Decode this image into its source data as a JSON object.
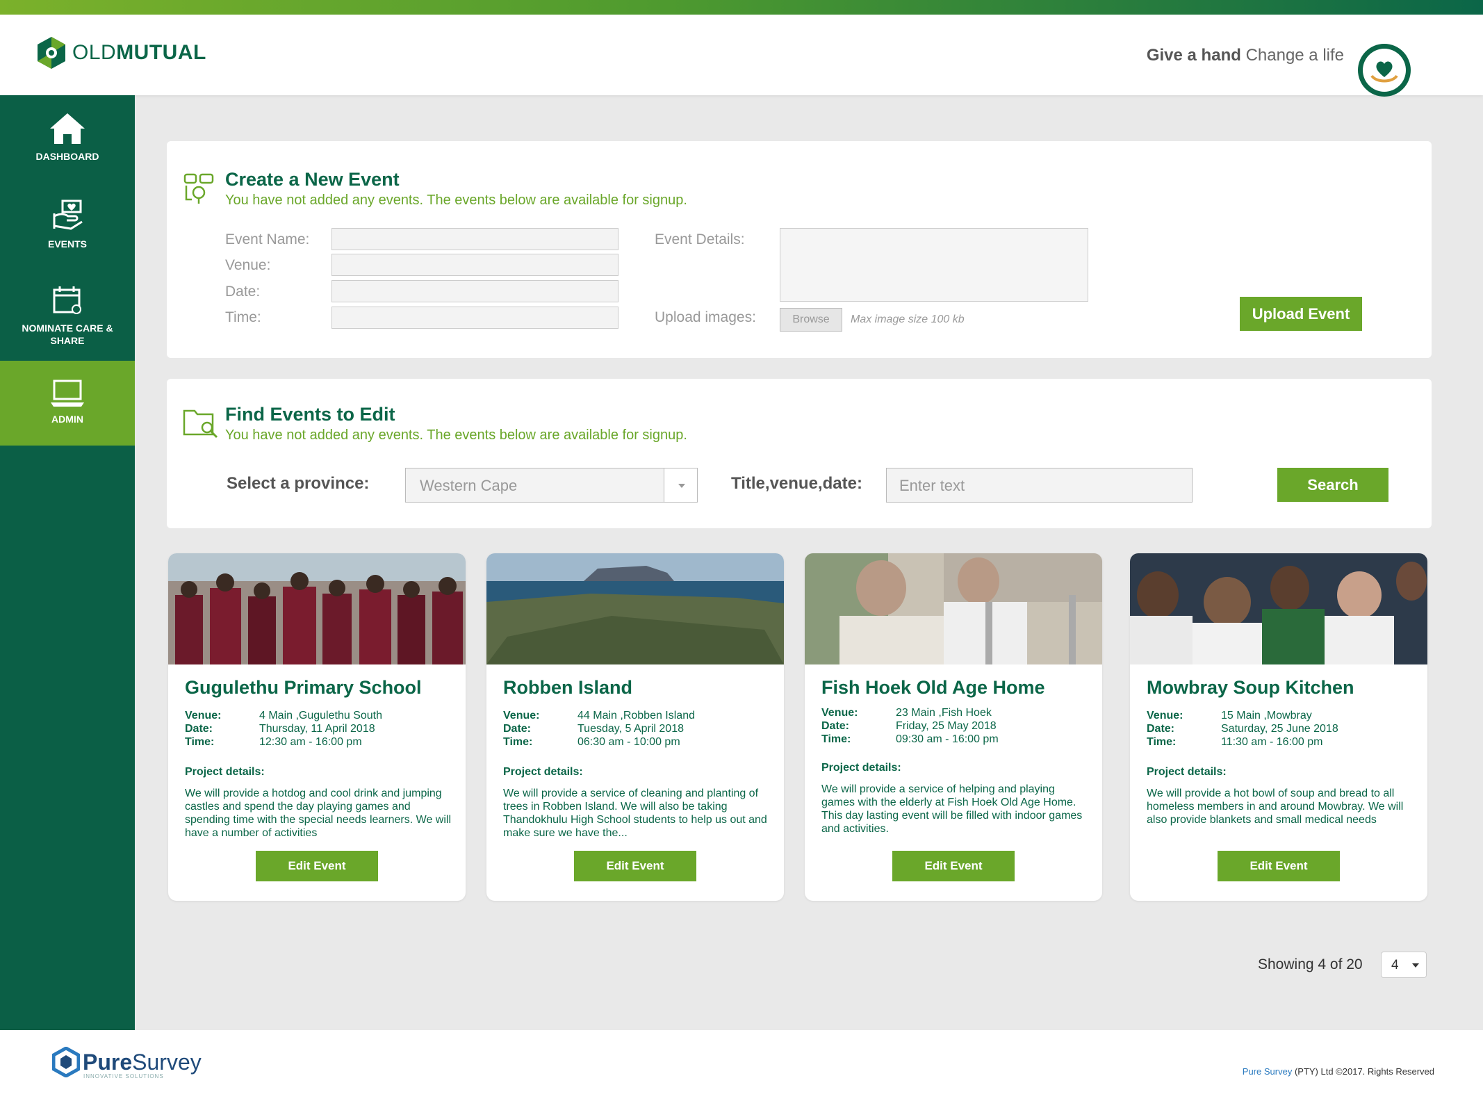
{
  "brand": {
    "part1": "OLD",
    "part2": "MUTUAL"
  },
  "slogan": {
    "bold": "Give a hand",
    "rest": "Change a life"
  },
  "sidebar": {
    "items": [
      {
        "label": "DASHBOARD",
        "icon": "home-icon"
      },
      {
        "label": "EVENTS",
        "icon": "events-hands-icon"
      },
      {
        "label": "NOMINATE CARE & SHARE",
        "icon": "calendar-icon"
      },
      {
        "label": "ADMIN",
        "icon": "laptop-icon",
        "active": true
      }
    ]
  },
  "create": {
    "title": "Create a New Event",
    "subtitle": "You have not added any events. The events below are available for signup.",
    "labels": {
      "event_name": "Event Name:",
      "venue": "Venue:",
      "date": "Date:",
      "time": "Time:",
      "event_details": "Event Details:",
      "upload_images": "Upload images:"
    },
    "browse": "Browse",
    "max_size": "Max image size 100 kb",
    "upload_button": "Upload Event"
  },
  "find": {
    "title": "Find Events to Edit",
    "subtitle": "You have not added any events. The events below are available for signup.",
    "province_label": "Select a province:",
    "province_value": "Western Cape",
    "search_label": "Title,venue,date:",
    "search_placeholder": "Enter text",
    "search_button": "Search"
  },
  "cards": [
    {
      "title": "Gugulethu Primary School",
      "venue_label": "Venue:",
      "venue": "4 Main ,Gugulethu South",
      "date_label": "Date:",
      "date": "Thursday, 11 April 2018",
      "time_label": "Time:",
      "time": "12:30 am - 16:00 pm",
      "details_label": "Project details:",
      "details": "We will provide a hotdog and cool drink and jumping castles and spend the day playing games and spending time with the special needs learners. We will have a number of activities",
      "button": "Edit Event"
    },
    {
      "title": "Robben Island",
      "venue_label": "Venue:",
      "venue": "44 Main ,Robben Island",
      "date_label": "Date:",
      "date": "Tuesday, 5 April 2018",
      "time_label": "Time:",
      "time": "06:30 am - 10:00 pm",
      "details_label": "Project details:",
      "details": "We will provide a service of cleaning and planting of trees in Robben Island. We will also be taking Thandokhulu High School students to help us out and make sure we have the...",
      "button": "Edit Event"
    },
    {
      "title": "Fish Hoek Old Age Home",
      "venue_label": "Venue:",
      "venue": "23 Main ,Fish Hoek",
      "date_label": "Date:",
      "date": "Friday, 25 May 2018",
      "time_label": "Time:",
      "time": "09:30 am - 16:00 pm",
      "details_label": "Project details:",
      "details": "We will provide a service of helping and playing games with the elderly at Fish Hoek Old Age Home. This day lasting event will be filled with indoor games and activities.",
      "button": "Edit Event"
    },
    {
      "title": "Mowbray Soup Kitchen",
      "venue_label": "Venue:",
      "venue": "15 Main ,Mowbray",
      "date_label": "Date:",
      "date": "Saturday, 25 June 2018",
      "time_label": "Time:",
      "time": "11:30 am - 16:00 pm",
      "details_label": "Project details:",
      "details": "We will provide a hot bowl of soup and bread to all homeless members in and around Mowbray. We will also provide blankets and small medical needs",
      "button": "Edit Event"
    }
  ],
  "pagination": {
    "showing": "Showing 4 of 20",
    "per_page": "4"
  },
  "footer": {
    "logo_pure": "Pure",
    "logo_survey": "Survey",
    "logo_tagline": "INNOVATIVE SOLUTIONS",
    "brand": "Pure Survey",
    "copyright": " (PTY) Ltd ©2017. Rights Reserved"
  },
  "colors": {
    "primary": "#0b6648",
    "accent": "#6aa72a",
    "sidebar": "#0b5f46"
  }
}
